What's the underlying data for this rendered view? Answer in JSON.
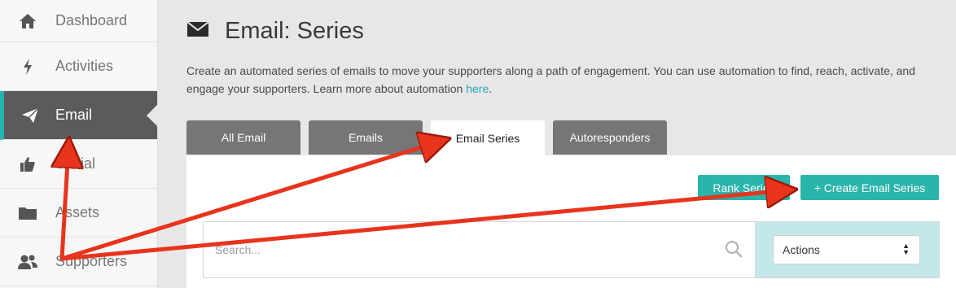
{
  "sidebar": {
    "items": [
      {
        "label": "Dashboard",
        "icon": "home-icon"
      },
      {
        "label": "Activities",
        "icon": "lightning-icon"
      },
      {
        "label": "Email",
        "icon": "paper-plane-icon",
        "active": true
      },
      {
        "label": "Social",
        "icon": "thumbs-up-icon"
      },
      {
        "label": "Assets",
        "icon": "folder-icon"
      },
      {
        "label": "Supporters",
        "icon": "users-icon"
      }
    ]
  },
  "page": {
    "title": "Email: Series",
    "title_icon": "envelope-icon",
    "description": "Create an automated series of emails to move your supporters along a path of engagement. You can use automation to find, reach, activate, and engage your supporters. Learn more about automation ",
    "description_link": "here",
    "description_end": "."
  },
  "tabs": [
    {
      "label": "All Email"
    },
    {
      "label": "Emails"
    },
    {
      "label": "Email Series",
      "active": true
    },
    {
      "label": "Autoresponders"
    }
  ],
  "toolbar": {
    "rank_label": "Rank Series",
    "create_label": "+ Create Email Series"
  },
  "search": {
    "placeholder": "Search...",
    "value": ""
  },
  "actions": {
    "selected": "Actions"
  },
  "colors": {
    "accent": "#2ab5ab",
    "sidebar_active": "#5b5b5b",
    "active_border": "#26b1b3",
    "tab_inactive": "#767676",
    "annotation_arrow": "#e8341c"
  }
}
